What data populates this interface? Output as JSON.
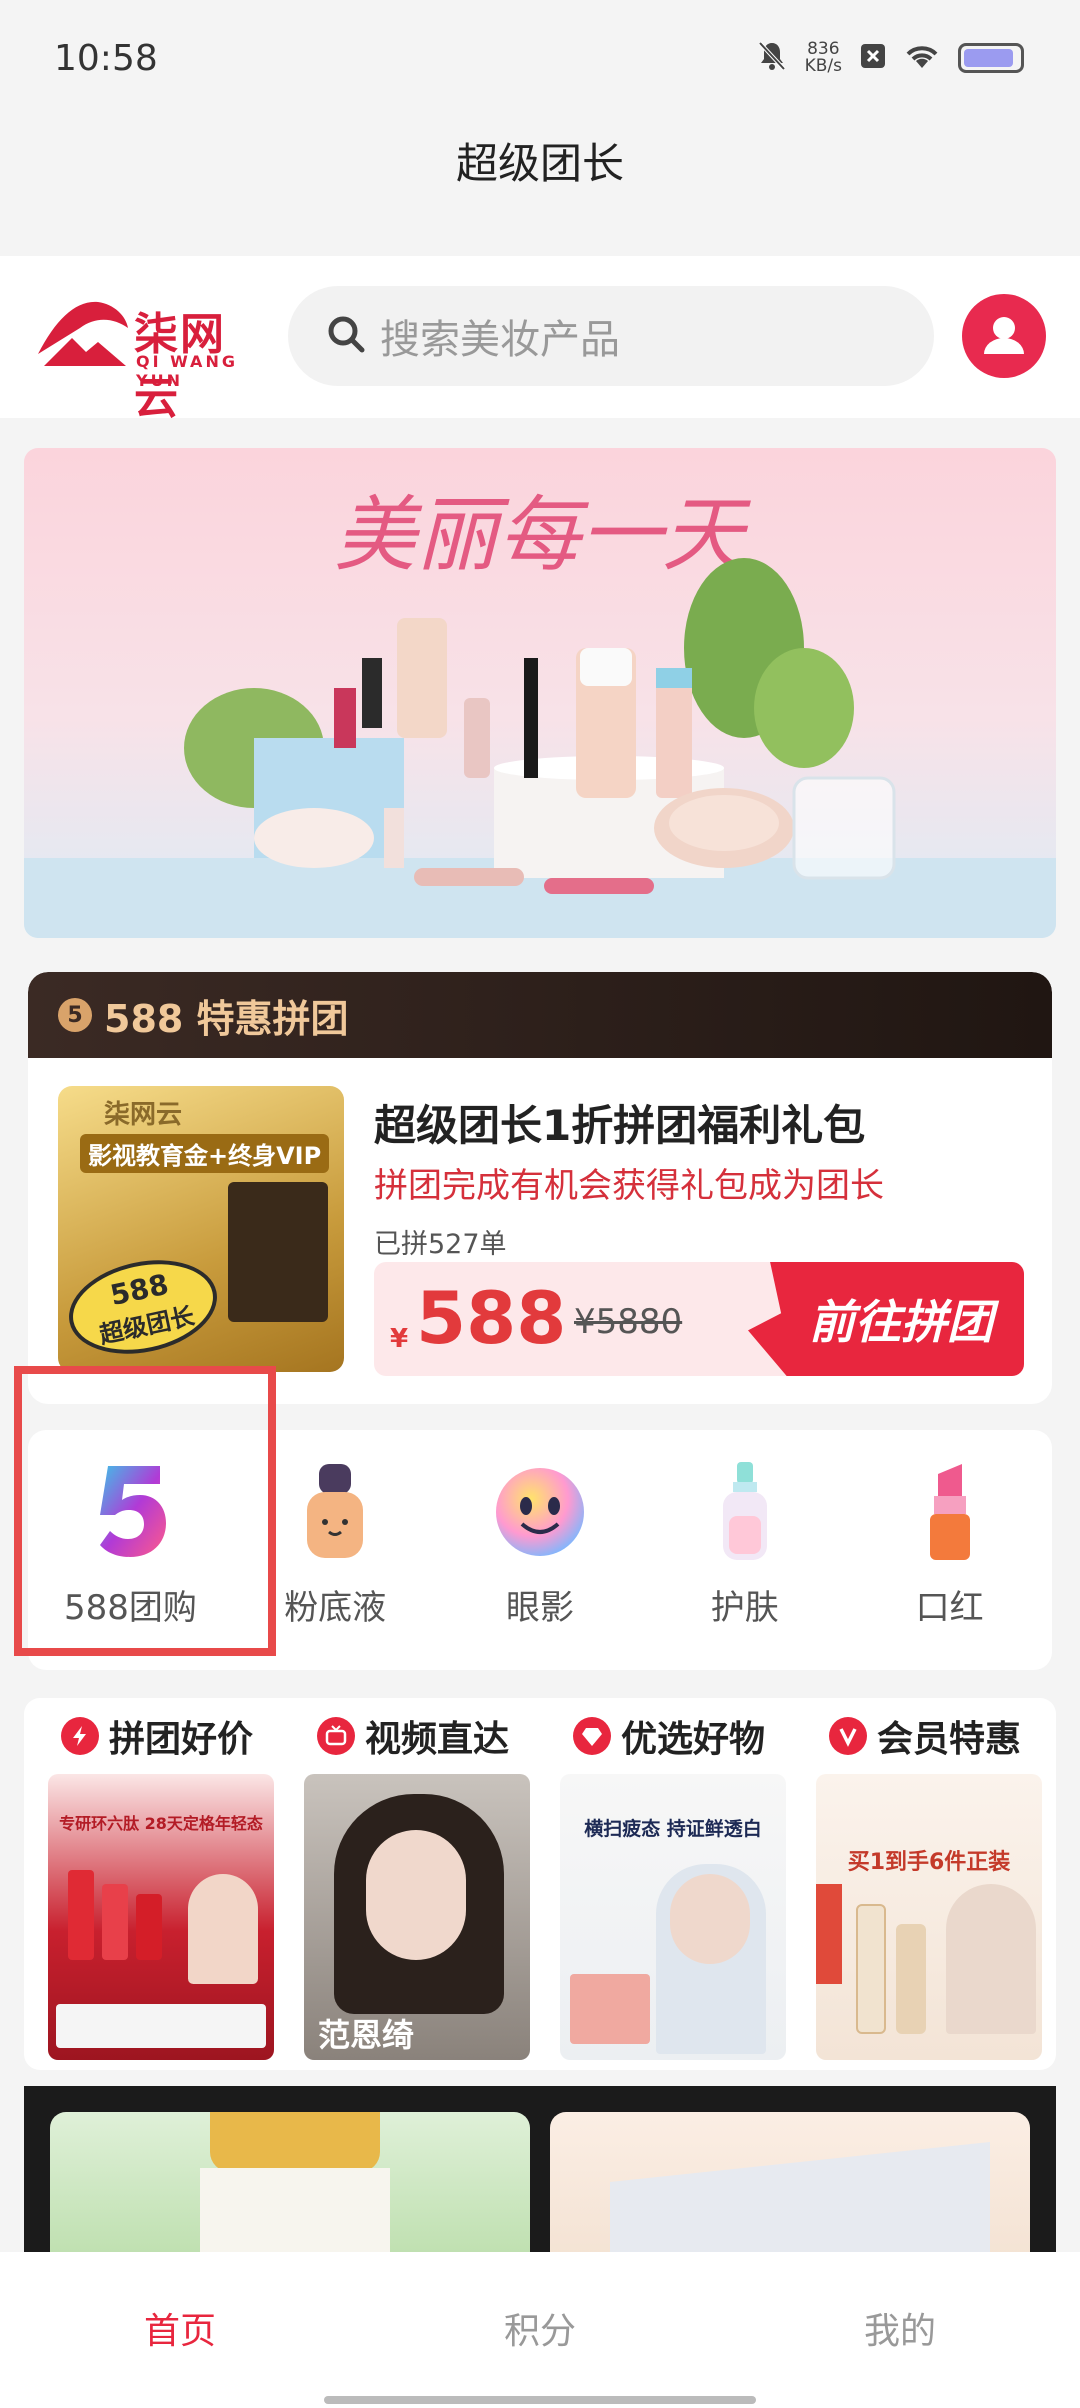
{
  "status_bar": {
    "time": "10:58",
    "net_speed_value": "836",
    "net_speed_unit": "KB/s"
  },
  "page_title": "超级团长",
  "header": {
    "logo_cn": "柒网云",
    "logo_en": "QI WANG YUN",
    "search_placeholder": "搜索美妆产品",
    "accent": "#e8263e"
  },
  "banner": {
    "title": "美丽每一天"
  },
  "group_buy": {
    "section_badge": "5",
    "section_title": "588 特惠拼团",
    "product_title": "超级团长1折拼团福利礼包",
    "product_subtitle": "拼团完成有机会获得礼包成为团长",
    "sold_count": "已拼527单",
    "currency": "¥",
    "price": "588",
    "original_price": "¥5880",
    "button_label": "前往拼团",
    "image_brand": "柒网云",
    "image_headline": "影视教育金+终身VIP",
    "image_badge_line1": "588",
    "image_badge_line2": "超级团长"
  },
  "categories": [
    {
      "label": "588团购",
      "icon": "number-five-icon"
    },
    {
      "label": "粉底液",
      "icon": "foundation-bottle-icon"
    },
    {
      "label": "眼影",
      "icon": "eyeshadow-smiley-icon"
    },
    {
      "label": "护肤",
      "icon": "skincare-bottle-icon"
    },
    {
      "label": "口红",
      "icon": "lipstick-icon"
    }
  ],
  "features": [
    {
      "label": "拼团好价",
      "icon": "lightning-icon"
    },
    {
      "label": "视频直达",
      "icon": "tv-icon"
    },
    {
      "label": "优选好物",
      "icon": "diamond-icon"
    },
    {
      "label": "会员特惠",
      "icon": "v-badge-icon"
    }
  ],
  "feature_images": {
    "kans_headline": "专研环六肽 28天定格年轻态",
    "person_name": "范恩绮",
    "proya_headline": "横扫疲态 持证鲜透白",
    "promo_headline": "买1到手6件正装"
  },
  "bottom_nav": {
    "items": [
      "首页",
      "积分",
      "我的"
    ],
    "active_index": 0
  }
}
